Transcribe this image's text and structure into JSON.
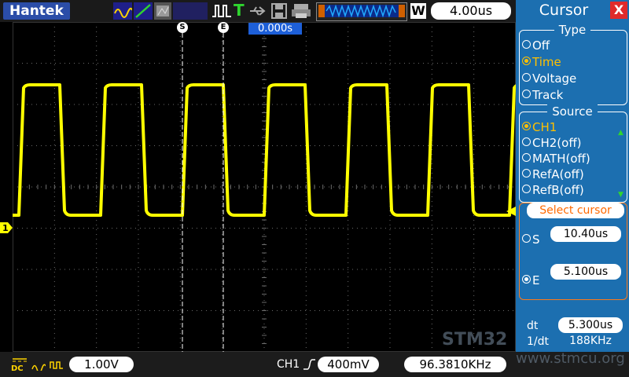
{
  "header": {
    "brand": "Hantek",
    "timebase": "4.00us",
    "memory_depth_icon": "waveform-memory-icon",
    "mode_letter": "W"
  },
  "scope": {
    "cursor_s_tag": "S",
    "cursor_e_tag": "E",
    "trigger_position": "0.000s",
    "channel_marker": "1",
    "trace_color": "#ffff00",
    "grid_color": "#6a6a6a",
    "waveform": {
      "levels": [
        "high",
        "low"
      ],
      "periods_visible": 6,
      "duty_cycle": 0.5
    }
  },
  "footer": {
    "coupling_dc": "DC",
    "ch1_scale": "1.00V",
    "trigger_source": "CH1",
    "trigger_level": "400mV",
    "frequency": "96.3810KHz"
  },
  "panel": {
    "title": "Cursor",
    "close": "X",
    "type": {
      "legend": "Type",
      "options": [
        "Off",
        "Time",
        "Voltage",
        "Track"
      ],
      "selected": "Time"
    },
    "source": {
      "legend": "Source",
      "options": [
        "CH1",
        "CH2(off)",
        "MATH(off)",
        "RefA(off)",
        "RefB(off)"
      ],
      "selected": "CH1"
    },
    "select_cursor": {
      "legend": "Select cursor",
      "s_label": "S",
      "s_value": "10.40us",
      "e_label": "E",
      "e_value": "5.100us",
      "selected": "E"
    },
    "measure": {
      "dt_label": "dt",
      "dt_value": "5.300us",
      "inv_dt_label": "1/dt",
      "inv_dt_value": "188KHz"
    }
  },
  "watermark": {
    "text": "STM32",
    "url": "www.stmcu.org"
  },
  "colors": {
    "accent": "#1c6fb0",
    "trace": "#ffff00",
    "select": "#ff7a1a",
    "selected_option": "#ffc000"
  }
}
